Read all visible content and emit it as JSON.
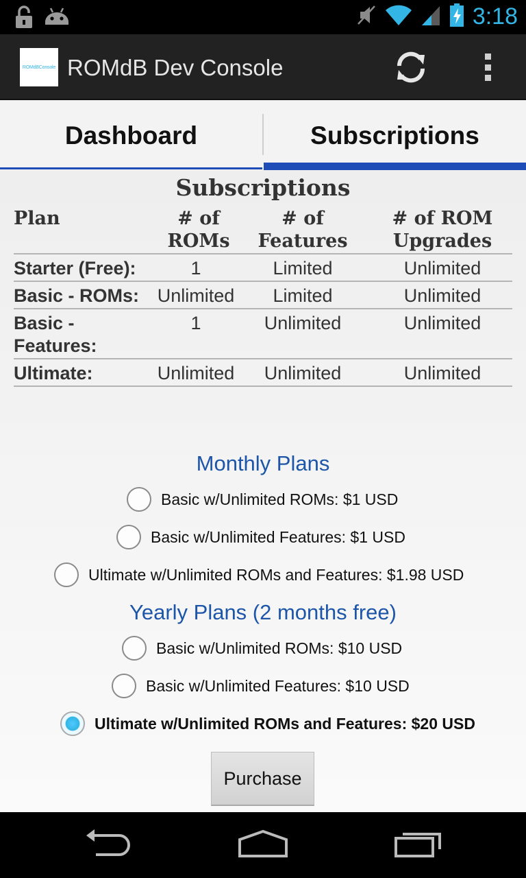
{
  "status_bar": {
    "time": "3:18",
    "icons": [
      "unlock-icon",
      "android-icon",
      "mute-icon",
      "wifi-icon",
      "signal-icon",
      "battery-charging-icon"
    ]
  },
  "action_bar": {
    "app_icon_text": "ROMdBConsole",
    "title": "ROMdB Dev Console",
    "actions": [
      "refresh-icon",
      "overflow-menu-icon"
    ]
  },
  "tabs": [
    {
      "label": "Dashboard",
      "selected": false
    },
    {
      "label": "Subscriptions",
      "selected": true
    }
  ],
  "subscriptions": {
    "title": "Subscriptions",
    "headers": {
      "plan": "Plan",
      "roms": [
        "# of",
        "ROMs"
      ],
      "features": [
        "# of",
        "Features"
      ],
      "upgrades": [
        "# of ROM",
        "Upgrades"
      ]
    },
    "rows": [
      {
        "plan": [
          "Starter (Free):"
        ],
        "roms": "1",
        "features": "Limited",
        "upgrades": "Unlimited"
      },
      {
        "plan": [
          "Basic - ROMs:"
        ],
        "roms": "Unlimited",
        "features": "Limited",
        "upgrades": "Unlimited"
      },
      {
        "plan": [
          "Basic -",
          "Features:"
        ],
        "roms": "1",
        "features": "Unlimited",
        "upgrades": "Unlimited"
      },
      {
        "plan": [
          "Ultimate:"
        ],
        "roms": "Unlimited",
        "features": "Unlimited",
        "upgrades": "Unlimited"
      }
    ]
  },
  "monthly": {
    "heading": "Monthly Plans",
    "options": [
      {
        "label": "Basic w/Unlimited ROMs: $1 USD",
        "checked": false
      },
      {
        "label": "Basic w/Unlimited Features: $1 USD",
        "checked": false
      },
      {
        "label": "Ultimate w/Unlimited ROMs and Features: $1.98 USD",
        "checked": false
      }
    ]
  },
  "yearly": {
    "heading": "Yearly Plans (2 months free)",
    "options": [
      {
        "label": "Basic w/Unlimited ROMs: $10 USD",
        "checked": false
      },
      {
        "label": "Basic w/Unlimited Features: $10 USD",
        "checked": false
      },
      {
        "label": "Ultimate w/Unlimited ROMs and Features: $20 USD",
        "checked": true
      }
    ]
  },
  "purchase_label": "Purchase",
  "nav_bar": [
    "back-icon",
    "home-icon",
    "recent-apps-icon"
  ],
  "colors": {
    "accent": "#33b5e5",
    "tab_indicator": "#1e4db7",
    "plans_heading": "#1d56a8",
    "action_bar": "#222222"
  }
}
